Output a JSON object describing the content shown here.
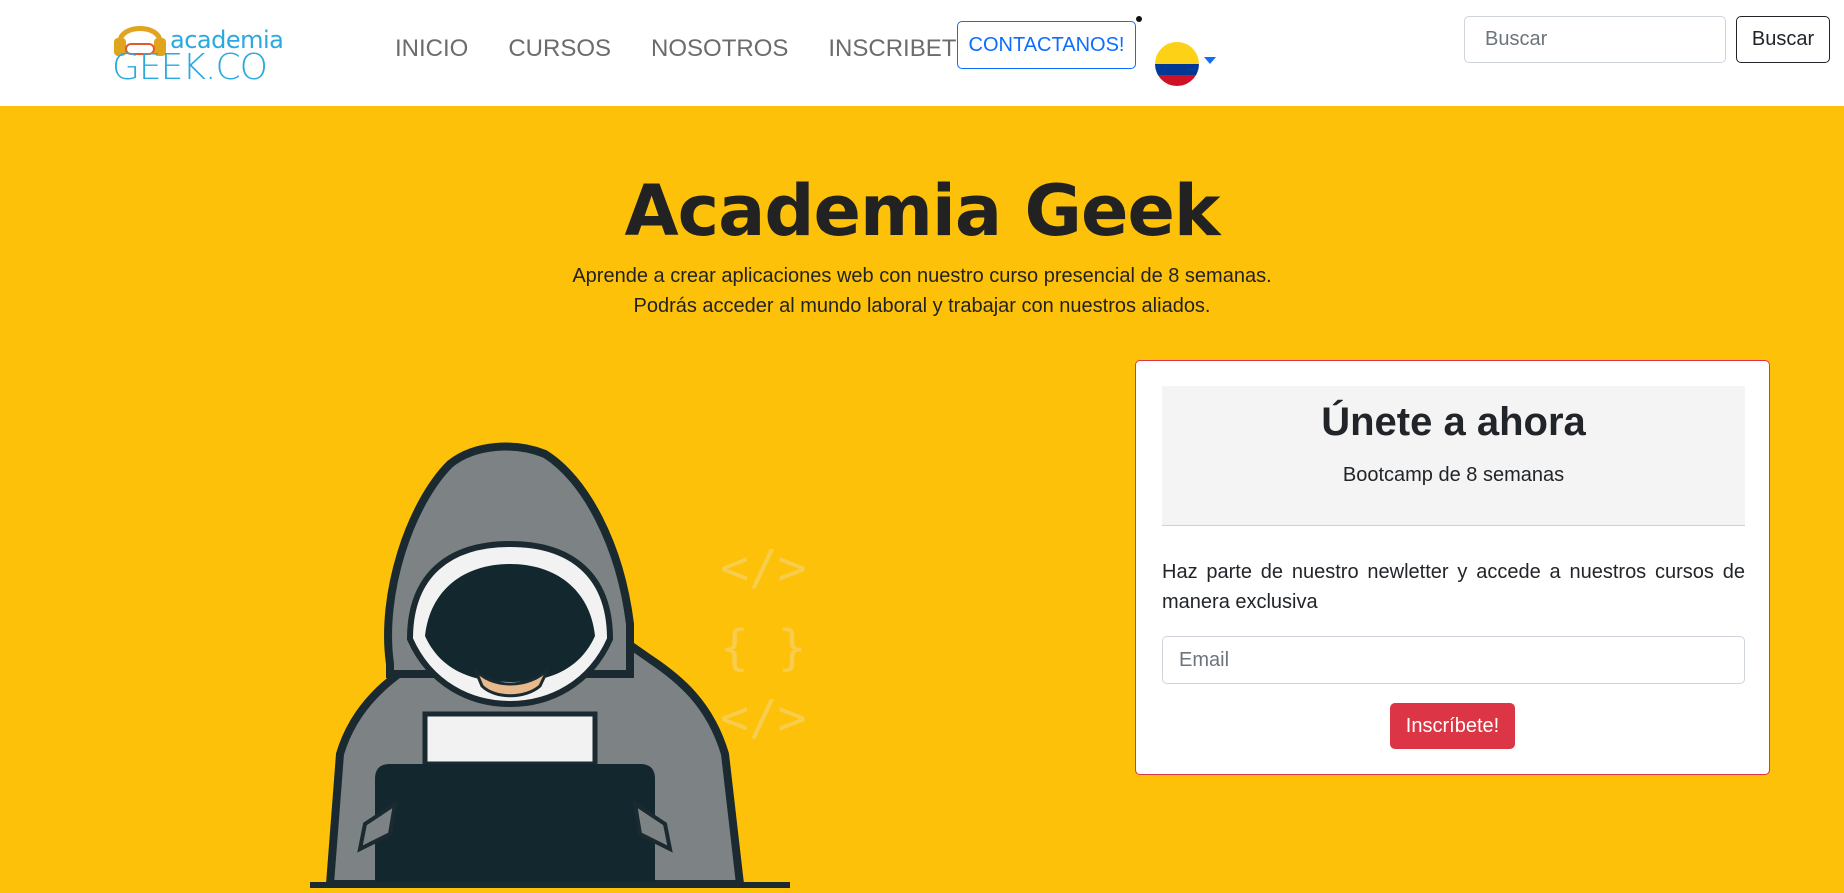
{
  "brand": {
    "small": "academia",
    "big": "GEEK.CO"
  },
  "nav": {
    "links": [
      "INICIO",
      "CURSOS",
      "NOSOTROS",
      "INSCRIBETE"
    ],
    "contact_label": "CONTACTANOS!",
    "flag_icon": "colombia-flag-icon"
  },
  "search": {
    "placeholder": "Buscar",
    "button_label": "Buscar"
  },
  "hero": {
    "title": "Academia Geek",
    "subtitle_line1": "Aprende a crear aplicaciones web con nuestro curso presencial de 8 semanas.",
    "subtitle_line2": "Podrás acceder al mundo laboral y trabajar con nuestros aliados."
  },
  "card": {
    "title": "Únete a ahora",
    "subtitle": "Bootcamp de 8 semanas",
    "text": "Haz parte de nuestro newletter y accede a nuestros cursos de manera exclusiva",
    "email_placeholder": "Email",
    "button_label": "Inscríbete!"
  },
  "colors": {
    "hero_bg": "#fdc10a",
    "primary": "#0d6efd",
    "danger": "#dc3545",
    "brand": "#2aa9df"
  }
}
